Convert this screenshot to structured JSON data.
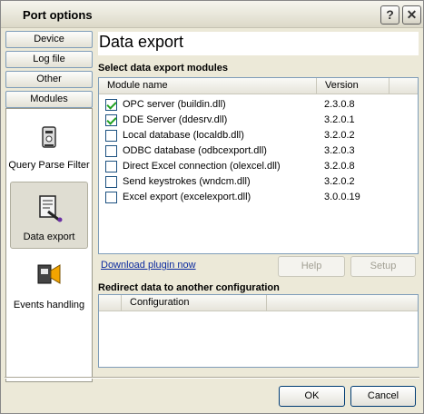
{
  "window": {
    "title": "Port options",
    "help_label": "?",
    "close_label": "✕"
  },
  "nav": {
    "buttons": [
      {
        "label": "Device"
      },
      {
        "label": "Log file"
      },
      {
        "label": "Other"
      },
      {
        "label": "Modules"
      }
    ],
    "items": [
      {
        "label": "Query Parse Filter",
        "icon": "filter-icon"
      },
      {
        "label": "Data export",
        "icon": "data-export-icon"
      },
      {
        "label": "Events handling",
        "icon": "events-icon"
      }
    ]
  },
  "main": {
    "title": "Data export",
    "modules_group_label": "Select data export modules",
    "modules_columns": [
      "Module name",
      "Version"
    ],
    "modules": [
      {
        "name": "OPC server (buildin.dll)",
        "version": "2.3.0.8",
        "checked": true
      },
      {
        "name": "DDE Server (ddesrv.dll)",
        "version": "3.2.0.1",
        "checked": true
      },
      {
        "name": "Local database (localdb.dll)",
        "version": "3.2.0.2",
        "checked": false
      },
      {
        "name": "ODBC database (odbcexport.dll)",
        "version": "3.2.0.3",
        "checked": false
      },
      {
        "name": "Direct Excel connection (olexcel.dll)",
        "version": "3.2.0.8",
        "checked": false
      },
      {
        "name": "Send keystrokes (wndcm.dll)",
        "version": "3.2.0.2",
        "checked": false
      },
      {
        "name": "Excel export (excelexport.dll)",
        "version": "3.0.0.19",
        "checked": false
      }
    ],
    "download_link": "Download plugin now",
    "help_button": "Help",
    "setup_button": "Setup",
    "redirect_group_label": "Redirect data to another configuration",
    "redirect_columns": [
      "Configuration"
    ]
  },
  "footer": {
    "ok_label": "OK",
    "cancel_label": "Cancel"
  },
  "colors": {
    "window_bg": "#ece9d8",
    "link": "#0b2a9f",
    "check": "#21a121"
  }
}
